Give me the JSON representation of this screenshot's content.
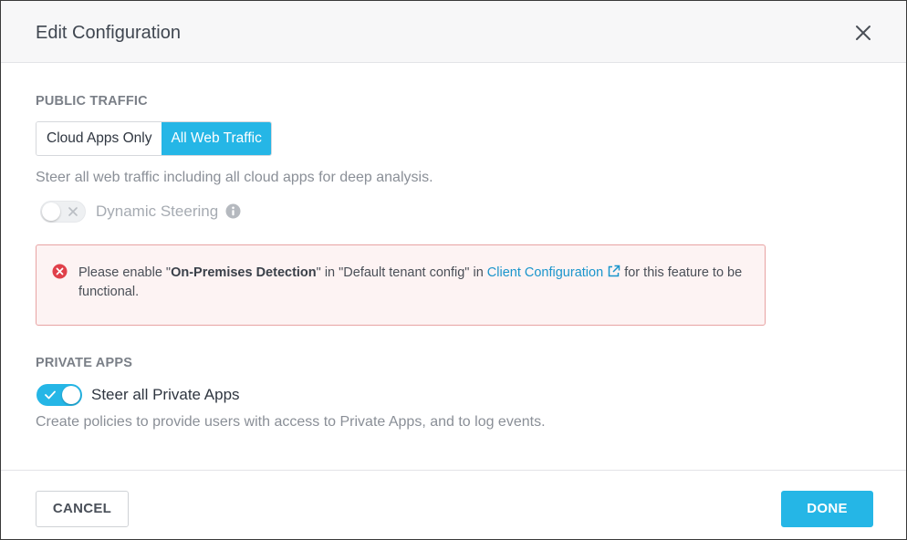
{
  "dialog": {
    "title": "Edit Configuration",
    "close_icon": "close-icon"
  },
  "public_traffic": {
    "label": "PUBLIC TRAFFIC",
    "options": [
      "Cloud Apps Only",
      "All Web Traffic"
    ],
    "selected": "All Web Traffic",
    "description": "Steer all web traffic including all cloud apps for deep analysis.",
    "dynamic_steering": {
      "label": "Dynamic Steering",
      "enabled": false,
      "info_icon": "info-icon"
    }
  },
  "alert": {
    "icon": "error-icon",
    "text_before": "Please enable \"",
    "bold": "On-Premises Detection",
    "text_middle": "\" in \"Default tenant config\" in ",
    "link": "Client Configuration",
    "link_icon": "external-link-icon",
    "text_after": " for this feature to be functional."
  },
  "private_apps": {
    "label": "PRIVATE APPS",
    "toggle_label": "Steer all Private Apps",
    "enabled": true,
    "description": "Create policies to provide users with access to Private Apps, and to log events."
  },
  "footer": {
    "cancel_label": "CANCEL",
    "done_label": "DONE"
  },
  "colors": {
    "accent": "#25b6e6",
    "error": "#e0404a",
    "link": "#1a95cc"
  }
}
